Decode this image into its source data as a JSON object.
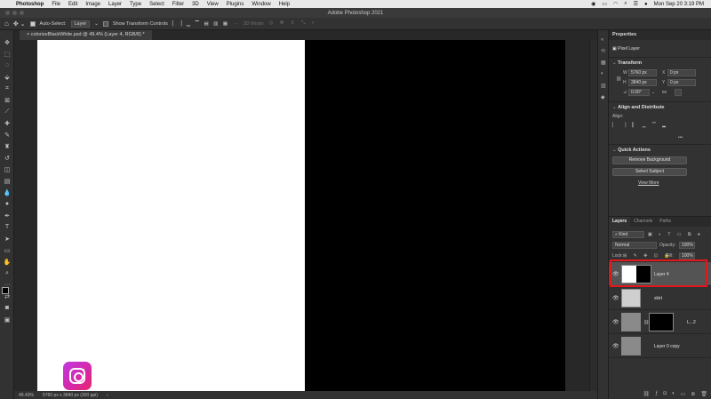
{
  "menubar": {
    "app": "Photoshop",
    "items": [
      "File",
      "Edit",
      "Image",
      "Layer",
      "Type",
      "Select",
      "Filter",
      "3D",
      "View",
      "Plugins",
      "Window",
      "Help"
    ],
    "datetime": "Mon Sep 20  3:19 PM"
  },
  "titlebar": {
    "title": "Adobe Photoshop 2021"
  },
  "options": {
    "auto_select_label": "Auto-Select:",
    "auto_select_target": "Layer",
    "show_transform_label": "Show Transform Controls",
    "mode_3d_label": "3D Mode:"
  },
  "document": {
    "tab_title": "colorizeBlackWhite.psd @ 49.4% (Layer 4, RGB/8) *"
  },
  "status": {
    "zoom": "49.43%",
    "size": "5760 px x 3840 px (300 ppi)"
  },
  "properties": {
    "tab": "Properties",
    "kind": "Pixel Layer",
    "transform": {
      "title": "Transform",
      "w_label": "W",
      "w_value": "5760 px",
      "h_label": "H",
      "h_value": "3840 px",
      "x_label": "X",
      "x_value": "0 px",
      "y_label": "Y",
      "y_value": "0 px",
      "angle_value": "0.00°"
    },
    "align": {
      "title": "Align and Distribute",
      "align_label": "Align:"
    },
    "quick": {
      "title": "Quick Actions",
      "remove_bg": "Remove Background",
      "select_subject": "Select Subject",
      "view_more": "View More"
    }
  },
  "layers": {
    "tabs": [
      "Layers",
      "Channels",
      "Paths"
    ],
    "filter_kind": "Kind",
    "blend_mode": "Normal",
    "opacity_label": "Opacity:",
    "opacity_value": "100%",
    "lock_label": "Lock:",
    "fill_label": "Fill:",
    "fill_value": "100%",
    "items": [
      {
        "name": "Layer 4"
      },
      {
        "name": "skirt"
      },
      {
        "name": "L...2"
      },
      {
        "name": "Layer 0 copy"
      }
    ]
  },
  "colors": {
    "highlight": "#e0181c",
    "panel": "#323232",
    "background": "#282828"
  }
}
